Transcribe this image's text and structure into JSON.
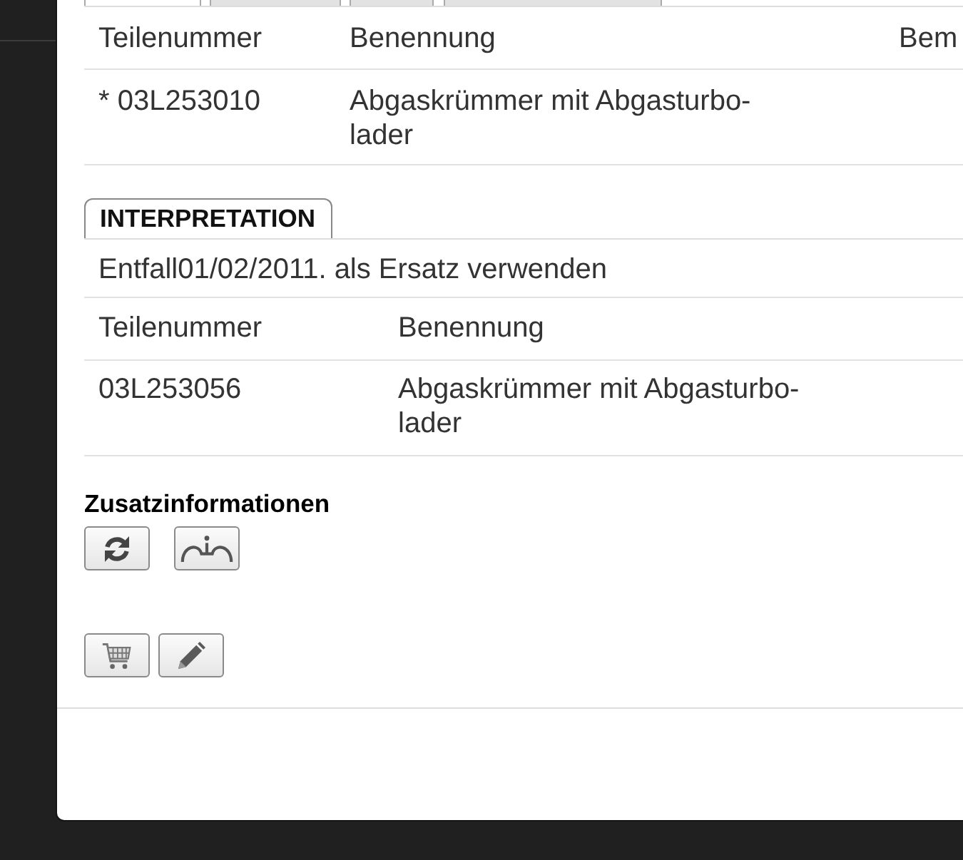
{
  "top_tabs": [
    {
      "selected": true
    },
    {
      "selected": false
    },
    {
      "selected": false
    },
    {
      "selected": false
    }
  ],
  "parts_table": {
    "columns": [
      "Teilenummer",
      "Benennung",
      "Bem"
    ],
    "rows": [
      [
        "* 03L253010",
        "Abgaskrümmer mit Abgasturbo-lader"
      ]
    ]
  },
  "interpretation": {
    "tab": "INTERPRETATION",
    "note": "Entfall01/02/2011. als Ersatz verwenden",
    "table": {
      "columns": [
        "Teilenummer",
        "Benennung"
      ],
      "rows": [
        [
          "03L253056",
          "Abgaskrümmer mit Abgasturbo-lader"
        ]
      ]
    }
  },
  "additional_info": {
    "title": "Zusatzinformationen",
    "buttons": [
      {
        "kind": "refresh"
      },
      {
        "kind": "junction"
      }
    ]
  },
  "actions": [
    {
      "kind": "cart"
    },
    {
      "kind": "edit"
    }
  ]
}
